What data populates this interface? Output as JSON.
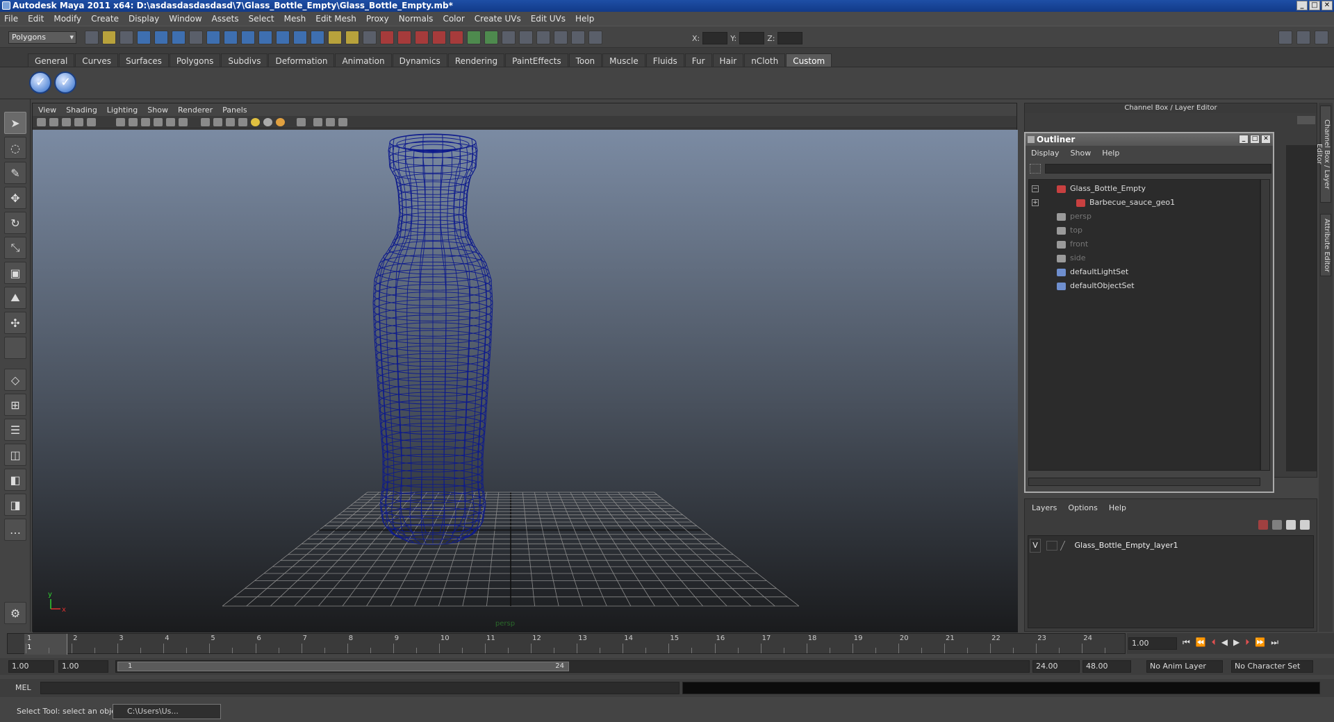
{
  "window": {
    "title": "Autodesk Maya 2011 x64: D:\\asdasdasdasdasd\\7\\Glass_Bottle_Empty\\Glass_Bottle_Empty.mb*"
  },
  "menubar": [
    "File",
    "Edit",
    "Modify",
    "Create",
    "Display",
    "Window",
    "Assets",
    "Select",
    "Mesh",
    "Edit Mesh",
    "Proxy",
    "Normals",
    "Color",
    "Create UVs",
    "Edit UVs",
    "Help"
  ],
  "toolbar": {
    "mode": "Polygons",
    "x_label": "X:",
    "y_label": "Y:",
    "z_label": "Z:"
  },
  "shelf_tabs": [
    "General",
    "Curves",
    "Surfaces",
    "Polygons",
    "Subdivs",
    "Deformation",
    "Animation",
    "Dynamics",
    "Rendering",
    "PaintEffects",
    "Toon",
    "Muscle",
    "Fluids",
    "Fur",
    "Hair",
    "nCloth",
    "Custom"
  ],
  "shelf_active": "Custom",
  "viewport": {
    "menu": [
      "View",
      "Shading",
      "Lighting",
      "Show",
      "Renderer",
      "Panels"
    ],
    "camera_label": "persp",
    "axis_x": "x",
    "axis_y": "y",
    "wire_color": "#0d1a8c"
  },
  "channel_box": {
    "title": "Channel Box / Layer Editor"
  },
  "outliner": {
    "title": "Outliner",
    "menu": [
      "Display",
      "Show",
      "Help"
    ],
    "items": [
      {
        "label": "Glass_Bottle_Empty",
        "type": "mesh-group",
        "dim": false
      },
      {
        "label": "Barbecue_sauce_geo1",
        "type": "mesh",
        "dim": false
      },
      {
        "label": "persp",
        "type": "camera",
        "dim": true
      },
      {
        "label": "top",
        "type": "camera",
        "dim": true
      },
      {
        "label": "front",
        "type": "camera",
        "dim": true
      },
      {
        "label": "side",
        "type": "camera",
        "dim": true
      },
      {
        "label": "defaultLightSet",
        "type": "set",
        "dim": false
      },
      {
        "label": "defaultObjectSet",
        "type": "set",
        "dim": false
      }
    ]
  },
  "layer_editor": {
    "menu": [
      "Layers",
      "Options",
      "Help"
    ],
    "layer": {
      "visible": "V",
      "name": "Glass_Bottle_Empty_layer1"
    }
  },
  "side_tabs": [
    "Channel Box / Layer Editor",
    "Attribute Editor"
  ],
  "timeline": {
    "ticks": [
      "1",
      "2",
      "3",
      "4",
      "5",
      "6",
      "7",
      "8",
      "9",
      "10",
      "11",
      "12",
      "13",
      "14",
      "15",
      "16",
      "17",
      "18",
      "19",
      "20",
      "21",
      "22",
      "23",
      "24"
    ],
    "current_frame": "1",
    "current_field": "1.00"
  },
  "range": {
    "start": "1.00",
    "start2": "1.00",
    "slider_start": "1",
    "slider_end": "24",
    "end": "24.00",
    "end2": "48.00",
    "anim_layer": "No Anim Layer",
    "character_set": "No Character Set"
  },
  "mel": {
    "label": "MEL"
  },
  "status": {
    "help": "Select Tool: select an object",
    "task": "C:\\Users\\Us..."
  }
}
